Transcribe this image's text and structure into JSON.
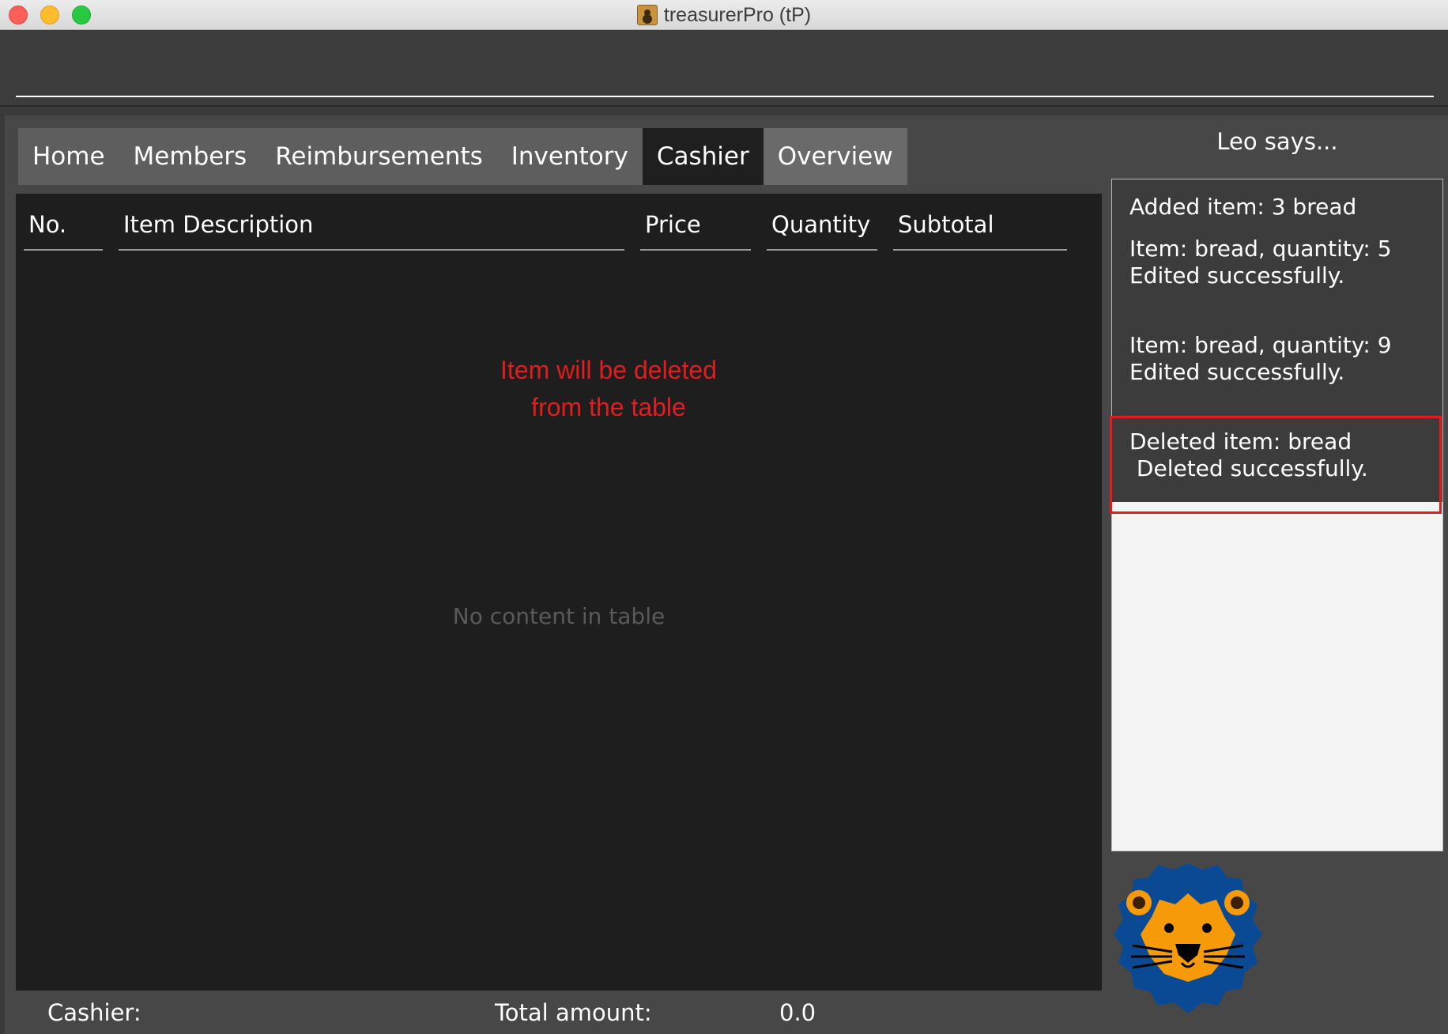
{
  "window": {
    "title": "treasurerPro (tP)"
  },
  "command": {
    "value": "",
    "placeholder": ""
  },
  "tabs": [
    {
      "label": "Home"
    },
    {
      "label": "Members"
    },
    {
      "label": "Reimbursements"
    },
    {
      "label": "Inventory"
    },
    {
      "label": "Cashier"
    },
    {
      "label": "Overview"
    }
  ],
  "active_tab": "Cashier",
  "table": {
    "columns": [
      "No.",
      "Item Description",
      "Price",
      "Quantity",
      "Subtotal"
    ],
    "rows": [],
    "empty_message": "No content in table"
  },
  "annotation": {
    "line1": "Item will be deleted",
    "line2": "from the table"
  },
  "status": {
    "cashier_label": "Cashier:",
    "cashier_value": "",
    "total_label": "Total amount:",
    "total_value": "0.0"
  },
  "assistant": {
    "title": "Leo says...",
    "messages": [
      {
        "text": "Added item: 3 bread"
      },
      {
        "text": "Item: bread, quantity: 5\nEdited successfully."
      },
      {
        "text": "Item: bread, quantity: 9\nEdited successfully."
      },
      {
        "text": "Deleted item: bread\n Deleted successfully."
      }
    ],
    "avatar": "lion-icon"
  },
  "colors": {
    "annotation_red": "#e01e1e",
    "lion_mane": "#0a4a94",
    "lion_face": "#f79a0a"
  }
}
